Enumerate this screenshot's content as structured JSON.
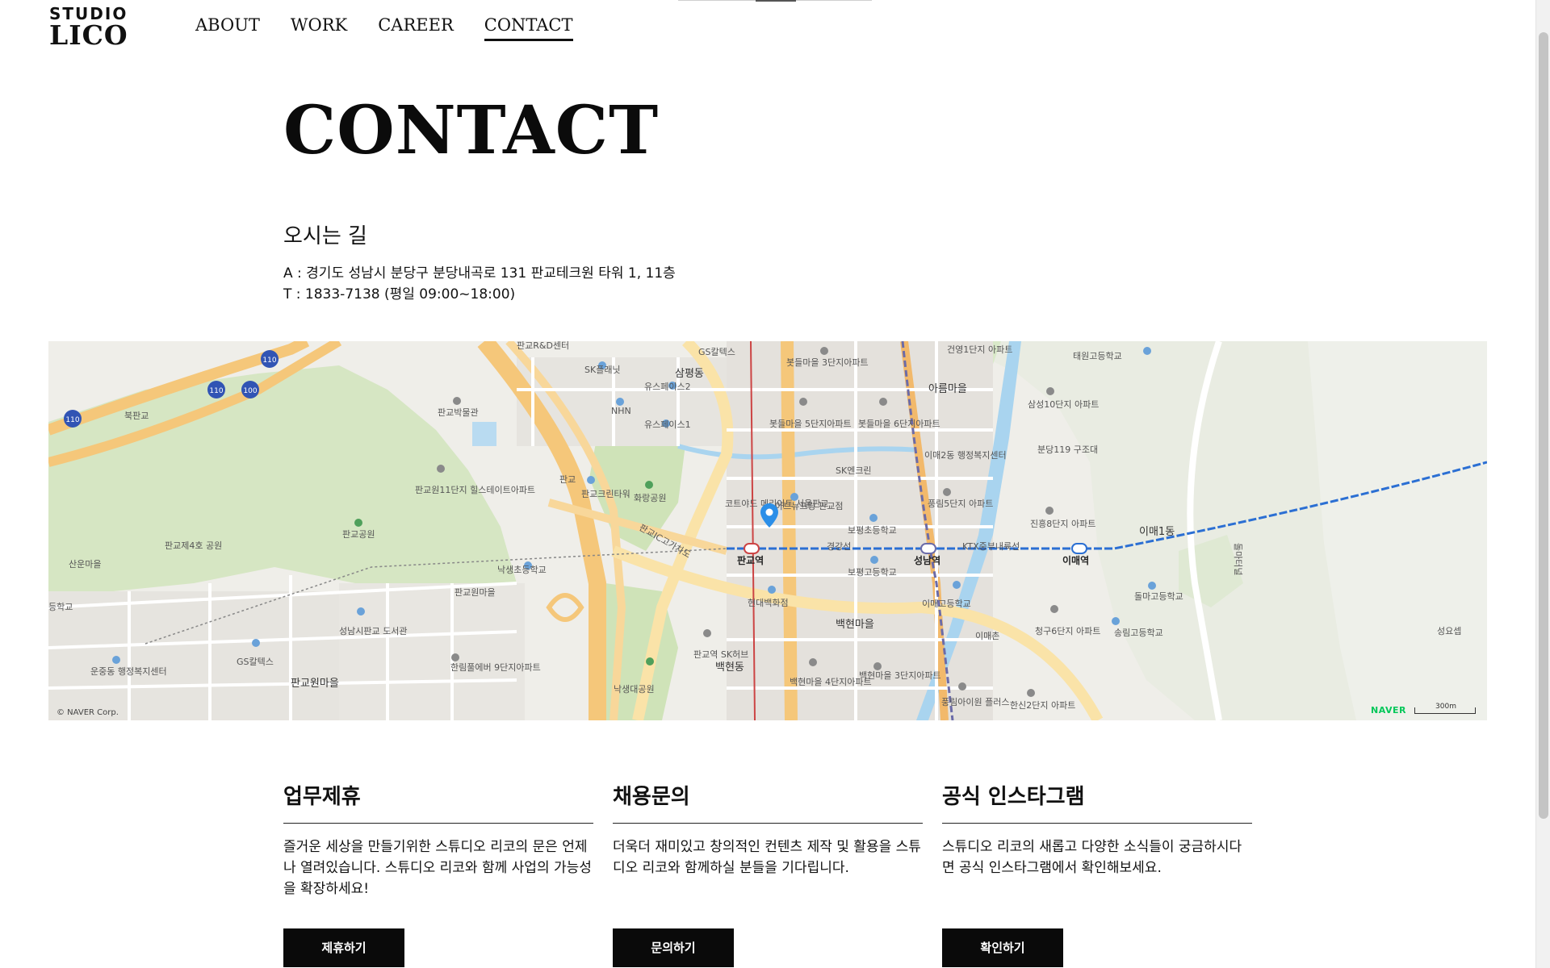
{
  "header": {
    "logo_top": "STUDIO",
    "logo_bottom": "LICO",
    "nav": [
      {
        "label": "ABOUT"
      },
      {
        "label": "WORK"
      },
      {
        "label": "CAREER"
      },
      {
        "label": "CONTACT",
        "active": true
      }
    ]
  },
  "main": {
    "title": "CONTACT",
    "directions": {
      "heading": "오시는 길",
      "address": "A : 경기도 성남시 분당구 분당내곡로 131 판교테크원 타워 1, 11층",
      "phone": "T : 1833-7138 (평일 09:00~18:00)"
    }
  },
  "map": {
    "copyright": "© NAVER Corp.",
    "brand": "NAVER",
    "scale": "300m",
    "marker_icon": "map-pin-icon",
    "labels": [
      "판교R&D센터",
      "GS칼텍스",
      "삼평동",
      "SK플래닛",
      "유스페이스2",
      "유스페이스1",
      "NHN",
      "봇들마을 3단지아파트",
      "봇들마을 5단지아파트",
      "봇들마을 6단지아파트",
      "건영1단지 아파트",
      "아름마을",
      "태원고등학교",
      "삼성10단지 아파트",
      "이매2동 행정복지센터",
      "분당119 구조대",
      "판교박물관",
      "판교원11단지 힐스테이트아파트",
      "판교",
      "판교크린타워",
      "화랑공원",
      "코트야드 메리어트 서울판교",
      "아브뉴프랑 판교점",
      "SK엔크린",
      "풍림5단지 아파트",
      "진흥8단지 아파트",
      "이매1동",
      "판교공원",
      "판교제4호 공원",
      "산운마을",
      "북판교",
      "경강선",
      "판교역",
      "보평초등학교",
      "성남역",
      "이매역",
      "KTX중부내륙선",
      "보평고등학교",
      "낙생초등학교",
      "판교원마을",
      "판교IC고가차도",
      "현대백화점",
      "이매고등학교",
      "돌마고등학교",
      "백현마을",
      "이매촌",
      "청구6단지 아파트",
      "송림고등학교",
      "성남시판교 도서관",
      "운중동 행정복지센터",
      "GS칼텍스",
      "한림풀에버 9단지아파트",
      "판교원마을",
      "판교역 SK허브",
      "백현동",
      "백현마을 4단지아파트",
      "백현마을 3단지아파트",
      "풍림아이원 플러스",
      "한신2단지 아파트",
      "낙생대공원",
      "성요셉",
      "등학교",
      "돌마터널"
    ]
  },
  "cards": [
    {
      "title": "업무제휴",
      "description": "즐거운 세상을 만들기위한 스튜디오 리코의 문은 언제나 열려있습니다. 스튜디오 리코와 함께 사업의 가능성을 확장하세요!",
      "button": "제휴하기"
    },
    {
      "title": "채용문의",
      "description": "더욱더 재미있고 창의적인 컨텐츠 제작 및 활용을 스튜디오 리코와 함께하실 분들을 기다립니다.",
      "button": "문의하기"
    },
    {
      "title": "공식 인스타그램",
      "description": "스튜디오 리코의 새롭고 다양한 소식들이 궁금하시다면 공식 인스타그램에서 확인해보세요.",
      "button": "확인하기"
    }
  ],
  "colors": {
    "accent": "#0a0a0a",
    "map_road_major": "#f5c77a",
    "map_park": "#cfe3b8",
    "map_water": "#a9d4ef",
    "naver_green": "#03c75a"
  }
}
